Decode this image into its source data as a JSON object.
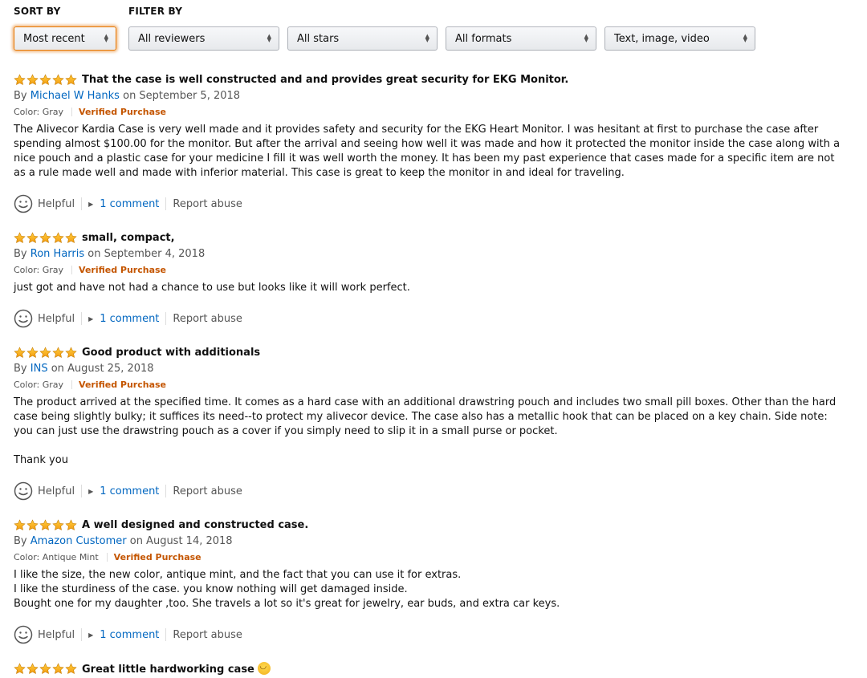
{
  "toolbar": {
    "sort_label": "SORT BY",
    "filter_label": "FILTER BY",
    "sort_value": "Most recent",
    "filters": [
      "All reviewers",
      "All stars",
      "All formats",
      "Text, image, video"
    ]
  },
  "colors": {
    "star": "#ffa41c",
    "link": "#0066c0",
    "verified": "#c45500",
    "focus": "#e77600"
  },
  "reviews": [
    {
      "rating": 5,
      "title": "That the case is well constructed and and provides great security for EKG Monitor.",
      "by": "By",
      "author": "Michael W Hanks",
      "date": "on September 5, 2018",
      "color": "Color: Gray",
      "verified": "Verified Purchase",
      "body": "The Alivecor Kardia Case is very well made and it provides safety and security for the EKG Heart Monitor. I was hesitant at first to purchase the case after spending almost $100.00 for the monitor. But after the arrival and seeing how well it was made and how it protected the monitor inside the case along with a nice pouch and a plastic case for your medicine I fill it was well worth the money. It has been my past experience that cases made for a specific item are not as a rule made well and made with inferior material. This case is great to keep the monitor in and ideal for traveling.",
      "helpful": "Helpful",
      "comments": "1 comment",
      "report": "Report abuse"
    },
    {
      "rating": 5,
      "title": "small, compact,",
      "by": "By",
      "author": "Ron Harris",
      "date": "on September 4, 2018",
      "color": "Color: Gray",
      "verified": "Verified Purchase",
      "body": "just got and have not had a chance to use but looks like it will work perfect.",
      "helpful": "Helpful",
      "comments": "1 comment",
      "report": "Report abuse"
    },
    {
      "rating": 5,
      "title": "Good product with additionals",
      "by": "By",
      "author": "INS",
      "date": "on August 25, 2018",
      "color": "Color: Gray",
      "verified": "Verified Purchase",
      "body": "The product arrived at the specified time. It comes as a hard case with an additional drawstring pouch and includes two small pill boxes. Other than the hard case being slightly bulky; it suffices its need--to protect my alivecor device. The case also has a metallic hook that can be placed on a key chain. Side note: you can just use the drawstring pouch as a cover if you simply need to slip it in a small purse or pocket.\n\nThank you",
      "helpful": "Helpful",
      "comments": "1 comment",
      "report": "Report abuse"
    },
    {
      "rating": 5,
      "title": "A well designed and constructed case.",
      "by": "By",
      "author": "Amazon Customer",
      "date": "on August 14, 2018",
      "color": "Color: Antique Mint",
      "verified": "Verified Purchase",
      "body": "I like the size, the new color, antique mint, and the fact that you can use it for extras.\nI like the sturdiness of the case. you know nothing will get damaged inside.\nBought one for my daughter ,too. She travels a lot so it's great for jewelry, ear buds, and extra car keys.",
      "helpful": "Helpful",
      "comments": "1 comment",
      "report": "Report abuse"
    },
    {
      "rating": 5,
      "title": "Great little hardworking case",
      "title_icon": "smiling-face-emoji-icon"
    }
  ]
}
